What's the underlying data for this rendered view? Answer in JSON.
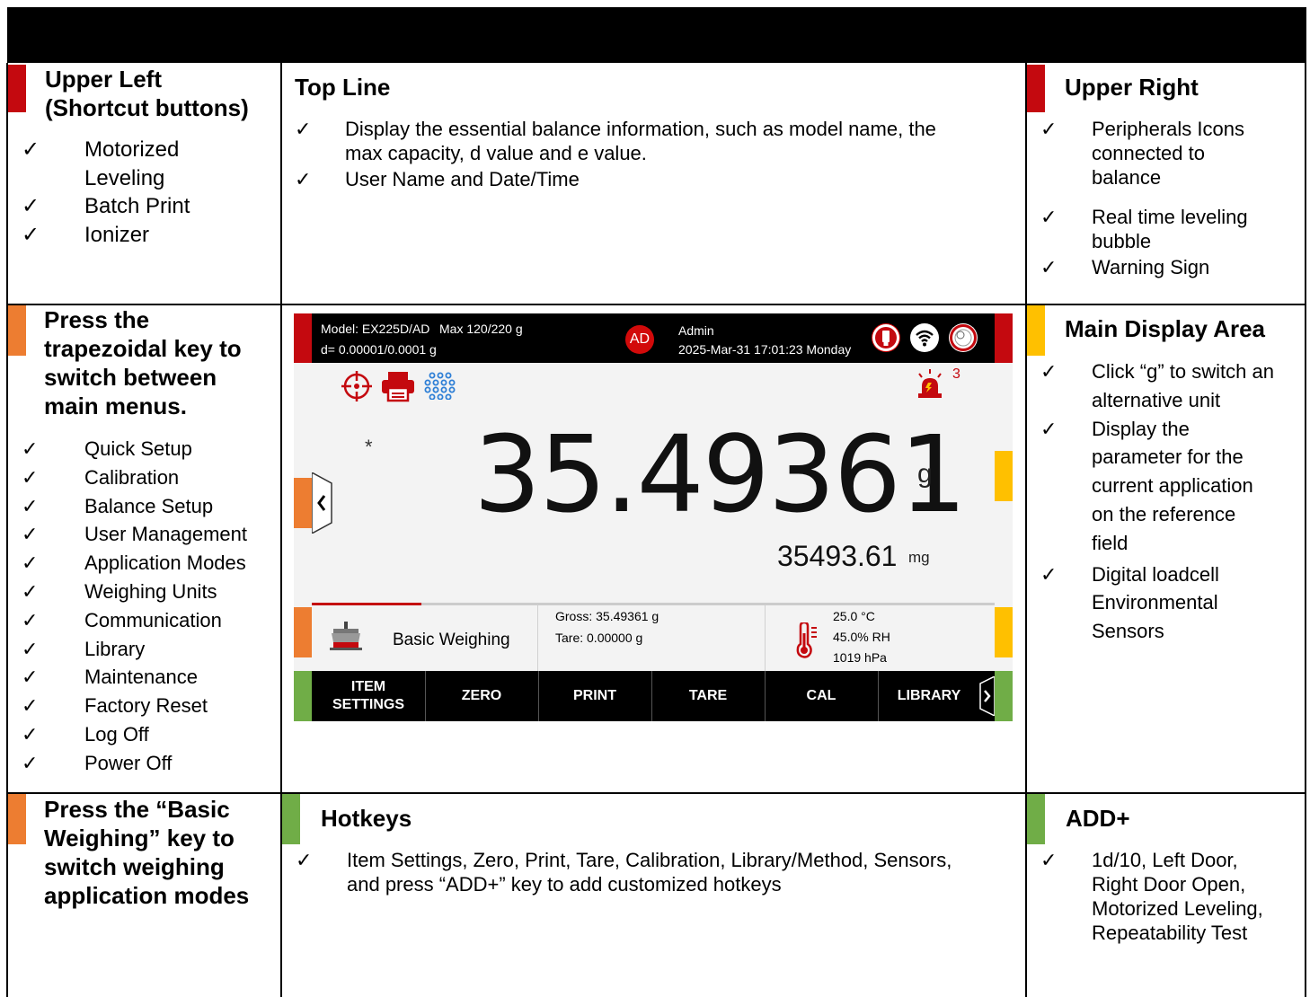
{
  "upper_left": {
    "title_line1": "Upper Left",
    "title_line2": "(Shortcut buttons)",
    "items": [
      "Motorized",
      "Leveling",
      "Batch Print",
      "Ionizer"
    ]
  },
  "top_line": {
    "title": "Top Line",
    "item1_line1": "Display the essential balance information, such as model name, the",
    "item1_line2": "max capacity, d value and e value.",
    "item2": "User Name and Date/Time"
  },
  "upper_right": {
    "title": "Upper Right",
    "item1_lines": [
      "Peripherals Icons",
      "connected to",
      "balance"
    ],
    "item2_lines": [
      "Real time leveling",
      "bubble"
    ],
    "item3": "Warning Sign"
  },
  "menus": {
    "title_lines": [
      "Press the",
      "trapezoidal key to",
      "switch between",
      "main menus."
    ],
    "items": [
      "Quick Setup",
      "Calibration",
      "Balance Setup",
      "User Management",
      "Application Modes",
      "Weighing Units",
      "Communication",
      "Library",
      "Maintenance",
      "Factory Reset",
      "Log Off",
      "Power Off"
    ]
  },
  "main_display": {
    "title": "Main Display Area",
    "item1_lines": [
      "Click “g” to switch an",
      "alternative unit"
    ],
    "item2_lines": [
      "Display the",
      "parameter for the",
      "current application",
      "on the reference",
      "field"
    ],
    "item3_lines": [
      "Digital loadcell",
      "Environmental",
      "Sensors"
    ]
  },
  "basic_weighing": {
    "title_lines": [
      "Press the “Basic",
      "Weighing” key to",
      "switch weighing",
      "application modes"
    ]
  },
  "hotkeys": {
    "title": "Hotkeys",
    "line1": "Item Settings, Zero, Print, Tare, Calibration, Library/Method, Sensors,",
    "line2": "and press “ADD+” key to add customized hotkeys"
  },
  "add_plus": {
    "title": "ADD+",
    "lines": [
      "1d/10, Left Door,",
      "Right Door Open,",
      "Motorized Leveling,",
      "Repeatability Test"
    ]
  },
  "check": "✓",
  "screen": {
    "model": "Model: EX225D/AD",
    "max": "Max 120/220 g",
    "d_value": "d= 0.00001/0.0001 g",
    "avatar": "AD",
    "user": "Admin",
    "datetime": "2025-Mar-31 17:01:23 Monday",
    "warning_count": "3",
    "stability_mark": "*",
    "main_value": "35.49361",
    "main_unit": "g",
    "ref_value": "35493.61",
    "ref_unit": "mg",
    "progress_fraction": 0.16,
    "app_mode": "Basic Weighing",
    "gross": "Gross: 35.49361 g",
    "tare": "Tare: 0.00000 g",
    "temperature": "25.0 °C",
    "humidity": "45.0% RH",
    "pressure": "1019 hPa",
    "keys": {
      "item_settings_l1": "ITEM",
      "item_settings_l2": "SETTINGS",
      "zero": "ZERO",
      "print": "PRINT",
      "tare": "TARE",
      "cal": "CAL",
      "library": "LIBRARY"
    }
  },
  "colors": {
    "red": "#c4090f",
    "orange": "#ed7d31",
    "amber": "#ffc000",
    "green": "#70ad47"
  },
  "icons": [
    "leveling-icon",
    "printer-icon",
    "ionizer-icon",
    "usb-icon",
    "wifi-icon",
    "level-bubble-icon",
    "warning-siren-icon",
    "balance-icon",
    "thermometer-icon",
    "chevron-left-icon",
    "chevron-right-icon"
  ]
}
